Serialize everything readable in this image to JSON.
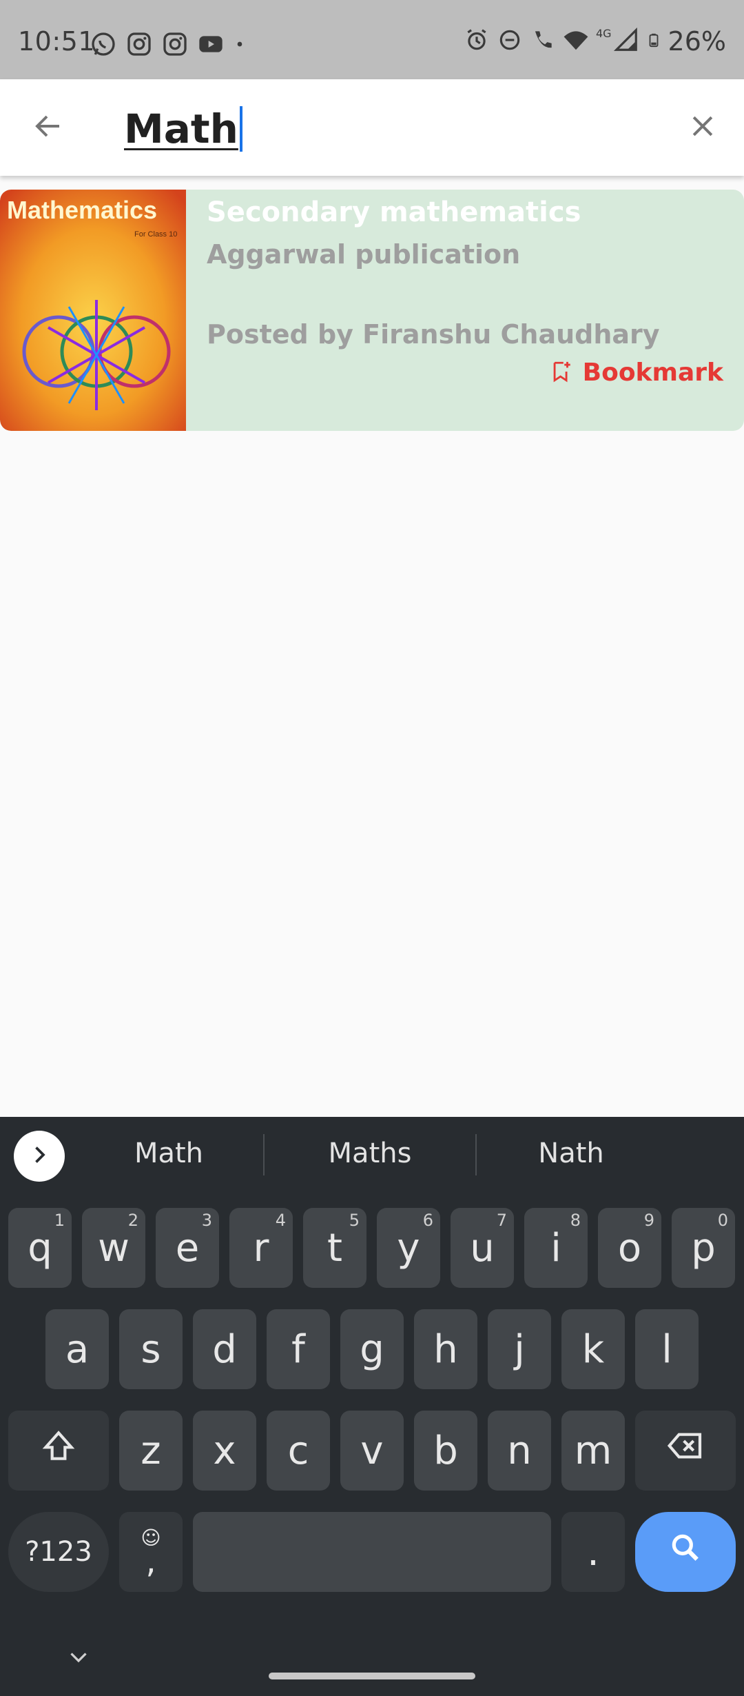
{
  "status_bar": {
    "time": "10:51",
    "network": "4G",
    "battery": "26%"
  },
  "search": {
    "query": "Math",
    "back_icon": "arrow-back-icon",
    "clear_icon": "close-icon"
  },
  "results": [
    {
      "cover_title": "Mathematics",
      "cover_subtitle": "For Class 10",
      "title": "Secondary mathematics",
      "publisher": "Aggarwal publication",
      "posted_by": "Posted by Firanshu Chaudhary",
      "bookmark_label": "Bookmark"
    }
  ],
  "keyboard": {
    "suggestions": [
      "Math",
      "Maths",
      "Nath"
    ],
    "row1": [
      "q",
      "w",
      "e",
      "r",
      "t",
      "y",
      "u",
      "i",
      "o",
      "p"
    ],
    "row1_hints": [
      "1",
      "2",
      "3",
      "4",
      "5",
      "6",
      "7",
      "8",
      "9",
      "0"
    ],
    "row2": [
      "a",
      "s",
      "d",
      "f",
      "g",
      "h",
      "j",
      "k",
      "l"
    ],
    "row3": [
      "z",
      "x",
      "c",
      "v",
      "b",
      "n",
      "m"
    ],
    "symbols_label": "?123",
    "comma_label": ",",
    "period_label": "."
  },
  "colors": {
    "accent_blue": "#5a9cf8",
    "bookmark_red": "#e53935",
    "card_bg": "#d7eadb"
  }
}
